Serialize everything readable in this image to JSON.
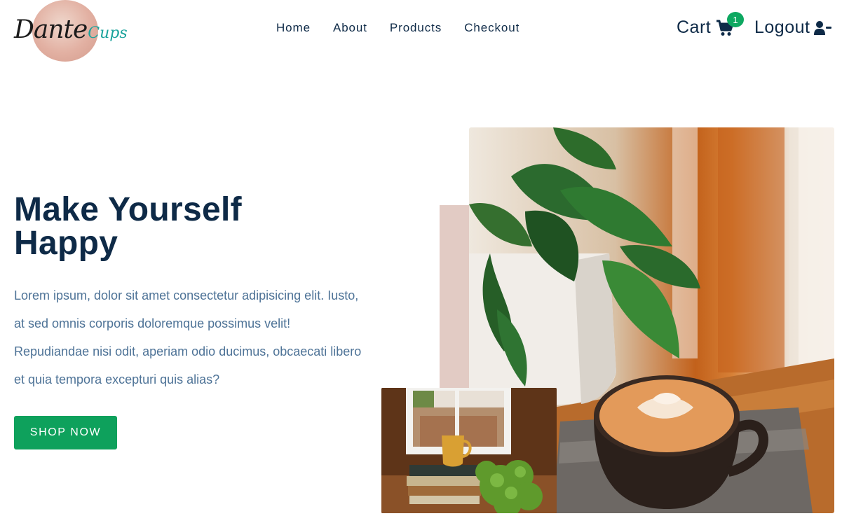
{
  "brand": {
    "part1": "Dante",
    "part2": "Cups"
  },
  "nav": {
    "items": [
      "Home",
      "About",
      "Products",
      "Checkout"
    ]
  },
  "cart": {
    "label": "Cart",
    "count": "1",
    "icon": "shopping-cart-icon"
  },
  "logout": {
    "label": "Logout",
    "icon": "user-minus-icon"
  },
  "hero": {
    "title": "Make Yourself Happy",
    "body": "Lorem ipsum, dolor sit amet consectetur adipisicing elit. Iusto, at sed omnis corporis doloremque possimus velit! Repudiandae nisi odit, aperiam odio ducimus, obcaecati libero et quia tempora excepturi quis alias?",
    "cta": "SHOP NOW"
  },
  "colors": {
    "primary": "#0e2a47",
    "accent": "#0ea15c",
    "body_text": "#4e7397",
    "blush": "#e2cbc4"
  }
}
